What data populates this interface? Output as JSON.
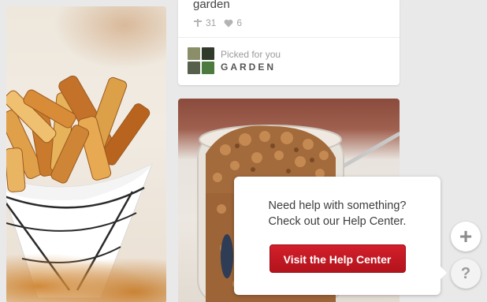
{
  "top_card": {
    "description": "garden",
    "repins": "31",
    "likes": "6",
    "picked_label": "Picked for you",
    "board_name": "GARDEN"
  },
  "help": {
    "line1": "Need help with something?",
    "line2": "Check out our Help Center.",
    "button_label": "Visit the Help Center"
  },
  "floating": {
    "add_symbol": "+",
    "help_symbol": "?"
  },
  "colors": {
    "accent_red": "#cb2027",
    "background": "#e9e9e9",
    "muted_text": "#a3a3a3"
  },
  "icons": {
    "repin": "pin-icon",
    "like": "heart-icon",
    "add": "plus-icon",
    "help": "question-icon"
  }
}
